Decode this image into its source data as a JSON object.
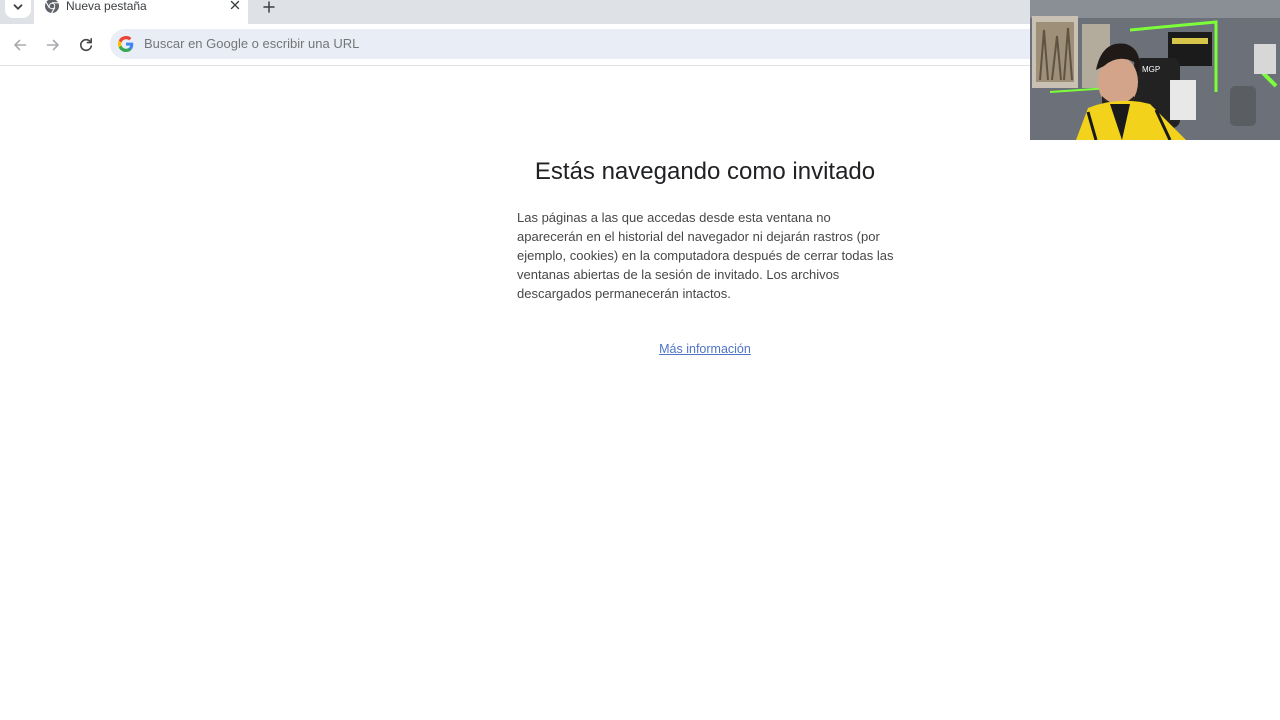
{
  "tabstrip": {
    "tab_search_icon": "chevron-down-icon",
    "tabs": [
      {
        "title": "Nueva pestaña",
        "favicon": "chrome-icon",
        "active": true
      }
    ],
    "close_icon": "close-icon",
    "new_tab_icon": "plus-icon"
  },
  "toolbar": {
    "back_icon": "arrow-left-icon",
    "forward_icon": "arrow-right-icon",
    "reload_icon": "reload-icon",
    "omnibox": {
      "engine_icon": "google-g-icon",
      "placeholder": "Buscar en Google o escribir una URL",
      "value": ""
    }
  },
  "guest_page": {
    "title": "Estás navegando como invitado",
    "description": "Las páginas a las que accedas desde esta ventana no aparecerán en el historial del navegador ni dejarán rastros (por ejemplo, cookies) en la computadora después de cerrar todas las ventanas abiertas de la sesión de invitado. Los archivos descargados permanecerán intactos.",
    "learn_more": "Más información"
  },
  "webcam_overlay": {
    "logo_text": "MGP"
  },
  "colors": {
    "tabstrip_bg": "#dee1e6",
    "omnibox_bg": "#e9eef6",
    "link": "#4f74c7",
    "webcam_led": "#7cff3a",
    "jacket_yellow": "#f2d21a"
  }
}
